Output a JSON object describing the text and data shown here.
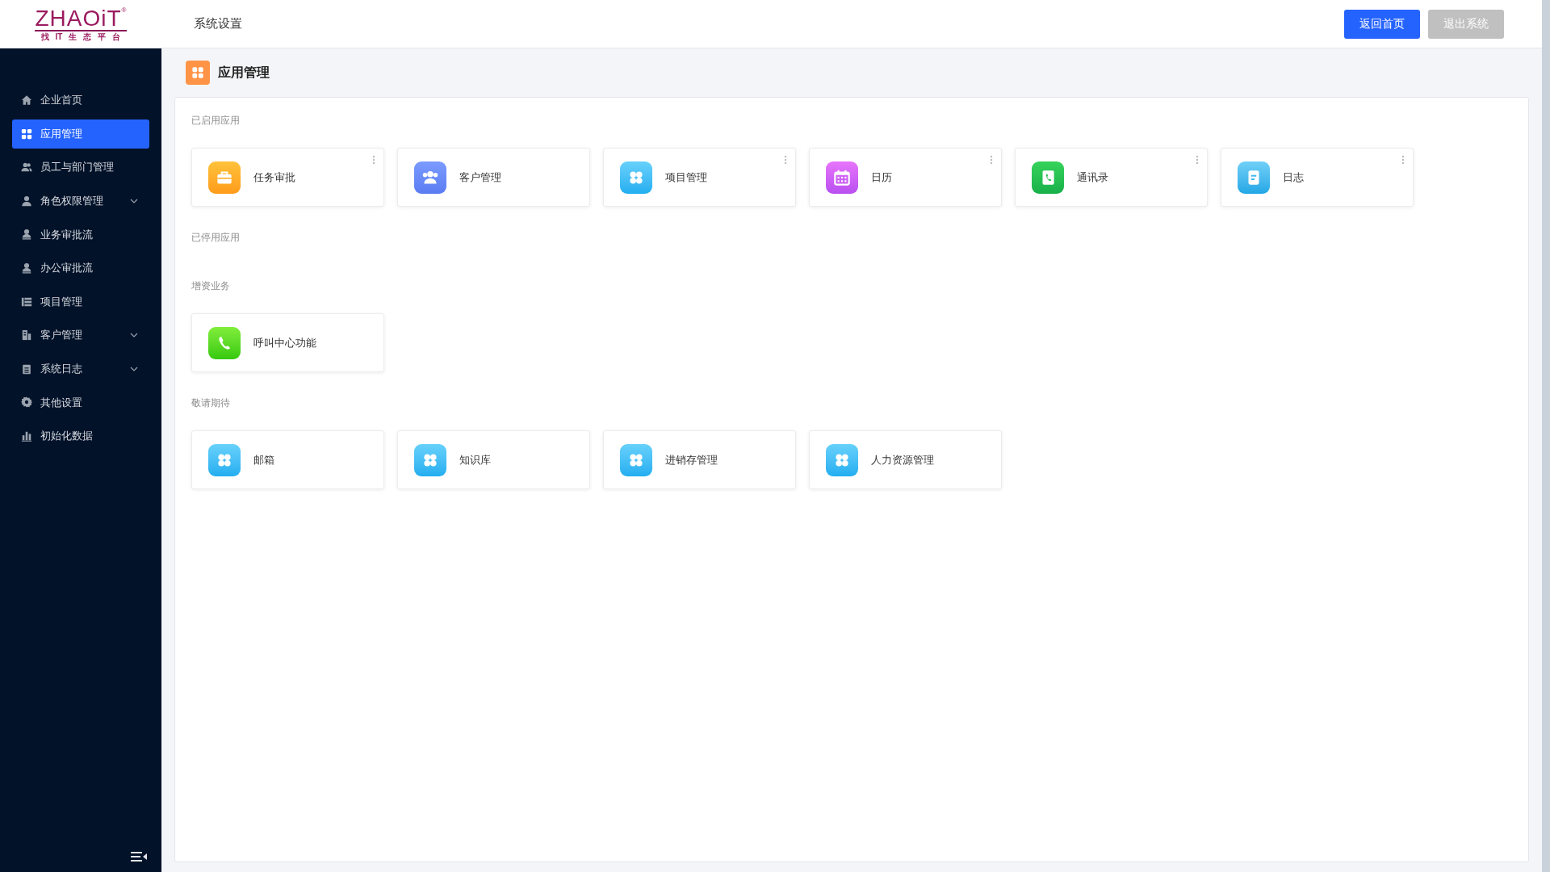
{
  "header": {
    "logo": "ZHAOiT",
    "logo_mark": "®",
    "logo_tagline": [
      "找",
      "IT",
      "生",
      "态",
      "平",
      "台"
    ],
    "title": "系统设置",
    "buttons": [
      {
        "label": "返回首页",
        "disabled": false
      },
      {
        "label": "退出系统",
        "disabled": true
      }
    ]
  },
  "sidebar": {
    "items": [
      {
        "label": "企业首页",
        "kind": "home",
        "selected": false,
        "expandable": false
      },
      {
        "label": "应用管理",
        "kind": "grid",
        "selected": true,
        "expandable": false
      },
      {
        "label": "员工与部门管理",
        "kind": "users",
        "selected": false,
        "expandable": false
      },
      {
        "label": "角色权限管理",
        "kind": "user",
        "selected": false,
        "expandable": true
      },
      {
        "label": "业务审批流",
        "kind": "approval",
        "selected": false,
        "expandable": false
      },
      {
        "label": "办公审批流",
        "kind": "approval",
        "selected": false,
        "expandable": false
      },
      {
        "label": "项目管理",
        "kind": "list",
        "selected": false,
        "expandable": false
      },
      {
        "label": "客户管理",
        "kind": "building",
        "selected": false,
        "expandable": true
      },
      {
        "label": "系统日志",
        "kind": "clipboard",
        "selected": false,
        "expandable": true
      },
      {
        "label": "其他设置",
        "kind": "gear",
        "selected": false,
        "expandable": false
      },
      {
        "label": "初始化数据",
        "kind": "chart",
        "selected": false,
        "expandable": false
      }
    ]
  },
  "page": {
    "title": "应用管理",
    "sections": [
      {
        "title": "已启用应用",
        "apps": [
          {
            "name": "任务审批",
            "kind": "briefcase",
            "menu": true
          },
          {
            "name": "客户管理",
            "kind": "users",
            "menu": false
          },
          {
            "name": "项目管理",
            "kind": "grid",
            "menu": true
          },
          {
            "name": "日历",
            "kind": "calendar",
            "menu": true
          },
          {
            "name": "通讯录",
            "kind": "contacts",
            "menu": true
          },
          {
            "name": "日志",
            "kind": "note",
            "menu": true
          }
        ]
      },
      {
        "title": "已停用应用"
      },
      {
        "title": "增资业务",
        "apps": [
          {
            "name": "呼叫中心功能",
            "kind": "phone",
            "menu": false
          }
        ]
      },
      {
        "title": "敬请期待",
        "apps": [
          {
            "name": "邮箱",
            "kind": "grid",
            "menu": false
          },
          {
            "name": "知识库",
            "kind": "grid",
            "menu": false
          },
          {
            "name": "进销存管理",
            "kind": "grid",
            "menu": false
          },
          {
            "name": "人力资源管理",
            "kind": "grid",
            "menu": false
          }
        ]
      }
    ]
  }
}
